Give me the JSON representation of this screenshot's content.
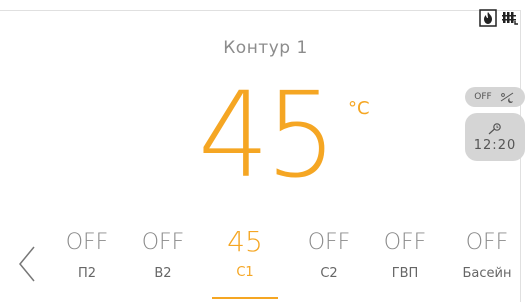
{
  "header": {
    "title": "Контур 1",
    "status_icons": [
      "flame-icon",
      "radiator-icon"
    ]
  },
  "main": {
    "temperature": "45",
    "unit": "°C"
  },
  "side_controls": {
    "mode_label": "OFF",
    "mode_icon": "sun-moon-icon",
    "schedule_icon": "schedule-icon",
    "schedule_time": "12:20"
  },
  "tabs": [
    {
      "value": "OFF",
      "label": "П2",
      "active": false
    },
    {
      "value": "OFF",
      "label": "В2",
      "active": false
    },
    {
      "value": "45",
      "label": "С1",
      "active": true
    },
    {
      "value": "OFF",
      "label": "С2",
      "active": false
    },
    {
      "value": "OFF",
      "label": "ГВП",
      "active": false
    },
    {
      "value": "OFF",
      "label": "Басейн",
      "active": false
    }
  ],
  "colors": {
    "accent": "#f5a623",
    "text_muted": "#8c8c8c",
    "pill_bg": "#d5d5d5"
  }
}
